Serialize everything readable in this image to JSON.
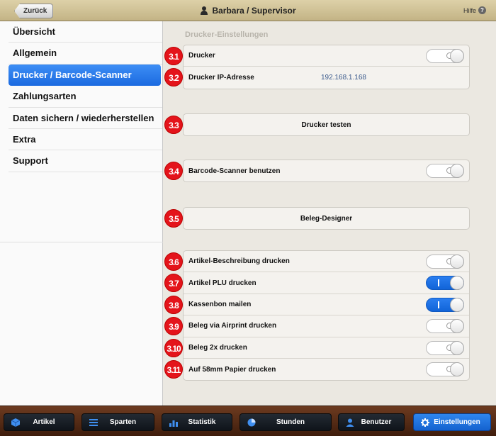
{
  "header": {
    "back_label": "Zurück",
    "title": "Barbara / Supervisor",
    "help_label": "Hilfe",
    "help_glyph": "?"
  },
  "sidebar": {
    "items": [
      {
        "label": "Übersicht"
      },
      {
        "label": "Allgemein"
      },
      {
        "label": "Drucker / Barcode-Scanner"
      },
      {
        "label": "Zahlungsarten"
      },
      {
        "label": "Daten sichern / wiederherstellen"
      },
      {
        "label": "Extra"
      },
      {
        "label": "Support"
      }
    ],
    "active_index": 2
  },
  "content": {
    "section_title": "Drucker-Einstellungen",
    "printer_label": "Drucker",
    "printer_on": false,
    "ip_label": "Drucker IP-Adresse",
    "ip_value": "192.168.1.168",
    "test_button": "Drucker testen",
    "scanner_label": "Barcode-Scanner benutzen",
    "scanner_on": false,
    "designer_button": "Beleg-Designer",
    "options": [
      {
        "label": "Artikel-Beschreibung drucken",
        "on": false,
        "badge": "3.6"
      },
      {
        "label": "Artikel PLU drucken",
        "on": true,
        "badge": "3.7"
      },
      {
        "label": "Kassenbon mailen",
        "on": true,
        "badge": "3.8"
      },
      {
        "label": "Beleg via Airprint drucken",
        "on": false,
        "badge": "3.9"
      },
      {
        "label": "Beleg 2x drucken",
        "on": false,
        "badge": "3.10"
      },
      {
        "label": "Auf 58mm Papier drucken",
        "on": false,
        "badge": "3.11"
      }
    ],
    "badges": {
      "b1": "3.1",
      "b2": "3.2",
      "b3": "3.3",
      "b4": "3.4",
      "b5": "3.5"
    }
  },
  "tabbar": {
    "tabs": [
      {
        "label": "Artikel",
        "icon": "cube-icon"
      },
      {
        "label": "Sparten",
        "icon": "list-icon"
      },
      {
        "label": "Statistik",
        "icon": "bar-chart-icon"
      },
      {
        "label": "Stunden",
        "icon": "pie-clock-icon"
      },
      {
        "label": "Benutzer",
        "icon": "user-icon"
      },
      {
        "label": "Einstellungen",
        "icon": "gear-icon"
      }
    ],
    "active_index": 5
  },
  "colors": {
    "accent": "#1b6ae0",
    "badge": "#e4141b",
    "header": "#c3b385"
  }
}
